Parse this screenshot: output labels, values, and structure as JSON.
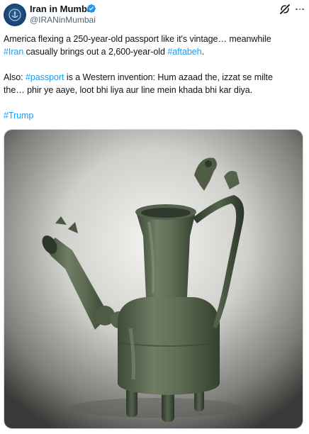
{
  "author": {
    "display_name": "Iran in Mumbai",
    "handle": "@IRANinMumbai",
    "verified_icon": "verified-badge-icon",
    "avatar_icon": "emblem-avatar-icon",
    "verified_color": "#1d9bf0"
  },
  "actions": {
    "grok_icon": "grok-icon",
    "more_icon": "more-options-icon"
  },
  "tweet": {
    "line1": "America flexing a 250-year-old passport like it's vintage… meanwhile",
    "line2_tag": "#Iran",
    "line2_mid": " casually brings out a 2,600-year-old ",
    "line2_tag2": "#aftabeh",
    "line2_end": ".",
    "line3_start": "Also: ",
    "line3_tag": "#passport",
    "line3_end": " is a Western invention: Hum azaad the, izzat se milte",
    "line4": "the… phir ye aaye, loot bhi liya aur line mein khada bhi kar diya.",
    "line5_tag": "#Trump",
    "hashtag_color": "#1d9bf0"
  },
  "media": {
    "description_icon": "ancient-bronze-ewer-image"
  }
}
